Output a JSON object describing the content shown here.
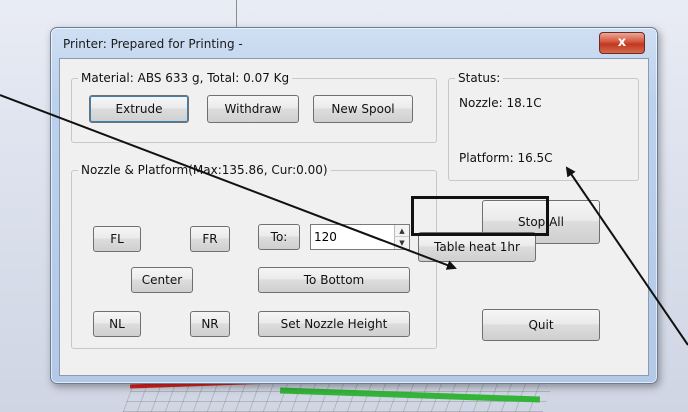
{
  "window": {
    "title": "Printer: Prepared for Printing -",
    "close_label": "x"
  },
  "material": {
    "legend": "Material: ABS 633 g,  Total: 0.07 Kg",
    "extrude_label": "Extrude",
    "withdraw_label": "Withdraw",
    "new_spool_label": "New Spool"
  },
  "status": {
    "legend": "Status:",
    "nozzle": "Nozzle: 18.1C",
    "platform": "Platform: 16.5C"
  },
  "nozzle_platform": {
    "legend": "Nozzle & Platform(Max:135.86, Cur:0.00)",
    "fl_label": "FL",
    "fr_label": "FR",
    "to_label": "To:",
    "to_value": "120",
    "center_label": "Center",
    "to_bottom_label": "To Bottom",
    "nl_label": "NL",
    "nr_label": "NR",
    "set_nozzle_height_label": "Set Nozzle Height"
  },
  "actions": {
    "stop_all_label": "Stop All",
    "table_heat_label": "Table heat 1hr",
    "quit_label": "Quit"
  },
  "colors": {
    "close_button": "#c1381f",
    "highlight_box": "#111111",
    "annotation_arrow": "#111111"
  }
}
